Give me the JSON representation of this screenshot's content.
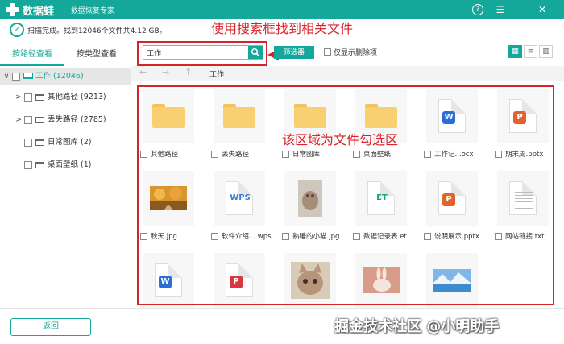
{
  "titlebar": {
    "brand": "数据蛙",
    "subtitle": "数据恢复专家",
    "help_glyph": "?",
    "menu_glyph": "☰",
    "minimize_glyph": "—",
    "close_glyph": "✕",
    "bg_color": "#14a89a"
  },
  "status": {
    "text": "扫描完成。找到12046个文件共4.12 GB。",
    "check_glyph": "✓"
  },
  "annotations": {
    "search_hint": "使用搜索框找到相关文件",
    "area_hint": "该区域为文件勾选区",
    "color": "#d9232a"
  },
  "sidebar": {
    "tabs": [
      {
        "label": "按路径查看"
      },
      {
        "label": "按类型查看"
      }
    ],
    "tree": [
      {
        "label": "工作 (12046)"
      },
      {
        "label": "其他路径 (9213)"
      },
      {
        "label": "丢失路径 (2785)"
      },
      {
        "label": "日常图库 (2)"
      },
      {
        "label": "桌面壁纸 (1)"
      }
    ]
  },
  "toolbar": {
    "search_value": "工作",
    "search_glyph": "⚲",
    "filter_label": "筛选器",
    "show_deleted_label": "仅显示删除项",
    "view_grid_glyph": "▦",
    "view_list_glyph": "≡",
    "view_detail_glyph": "▥"
  },
  "nav": {
    "back_glyph": "←",
    "forward_glyph": "→",
    "up_glyph": "↑",
    "path": "工作"
  },
  "files": [
    {
      "label": "其他路径",
      "kind": "folder"
    },
    {
      "label": "丢失路径",
      "kind": "folder"
    },
    {
      "label": "日常图库",
      "kind": "folder"
    },
    {
      "label": "桌面壁纸",
      "kind": "folder"
    },
    {
      "label": "工作记...ocx",
      "kind": "word",
      "badge": "W"
    },
    {
      "label": "期末周.pptx",
      "kind": "ppt",
      "badge": "P"
    },
    {
      "label": "秋天.jpg",
      "kind": "photo-autumn"
    },
    {
      "label": "软件介绍....wps",
      "kind": "wps",
      "tag": "WPS"
    },
    {
      "label": "熟睡的小猫.jpg",
      "kind": "photo-cat"
    },
    {
      "label": "数据记录表.et",
      "kind": "et",
      "tag": "ET"
    },
    {
      "label": "说明展示.pptx",
      "kind": "ppt",
      "badge": "P"
    },
    {
      "label": "网站链接.txt",
      "kind": "txt"
    },
    {
      "label": "",
      "kind": "word",
      "badge": "W"
    },
    {
      "label": "",
      "kind": "pdf",
      "badge": "P"
    },
    {
      "label": "",
      "kind": "photo-cat2"
    },
    {
      "label": "",
      "kind": "photo-rabbit"
    },
    {
      "label": "",
      "kind": "photo-lake"
    }
  ],
  "footer": {
    "back_label": "返回",
    "watermark": "掘金技术社区 @小明助手"
  }
}
